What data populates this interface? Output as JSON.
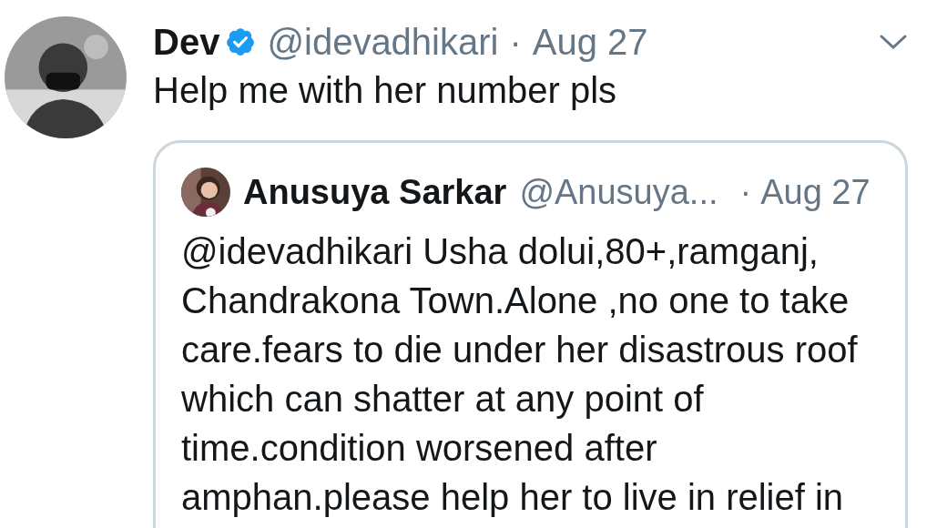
{
  "tweet": {
    "name": "Dev",
    "verified": true,
    "handle": "@idevadhikari",
    "separator": "·",
    "date": "Aug 27",
    "text": "Help me with her number pls",
    "quoted": {
      "name": "Anusuya Sarkar",
      "handle": "@Anusuya...",
      "separator": "·",
      "date": "Aug 27",
      "text": "@idevadhikari Usha dolui,80+,ramganj,\nChandrakona Town.Alone ,no one to take\ncare.fears to die under her disastrous roof\nwhich can shatter at any point of\ntime.condition worsened after\namphan.please help her to live in relief in"
    }
  }
}
